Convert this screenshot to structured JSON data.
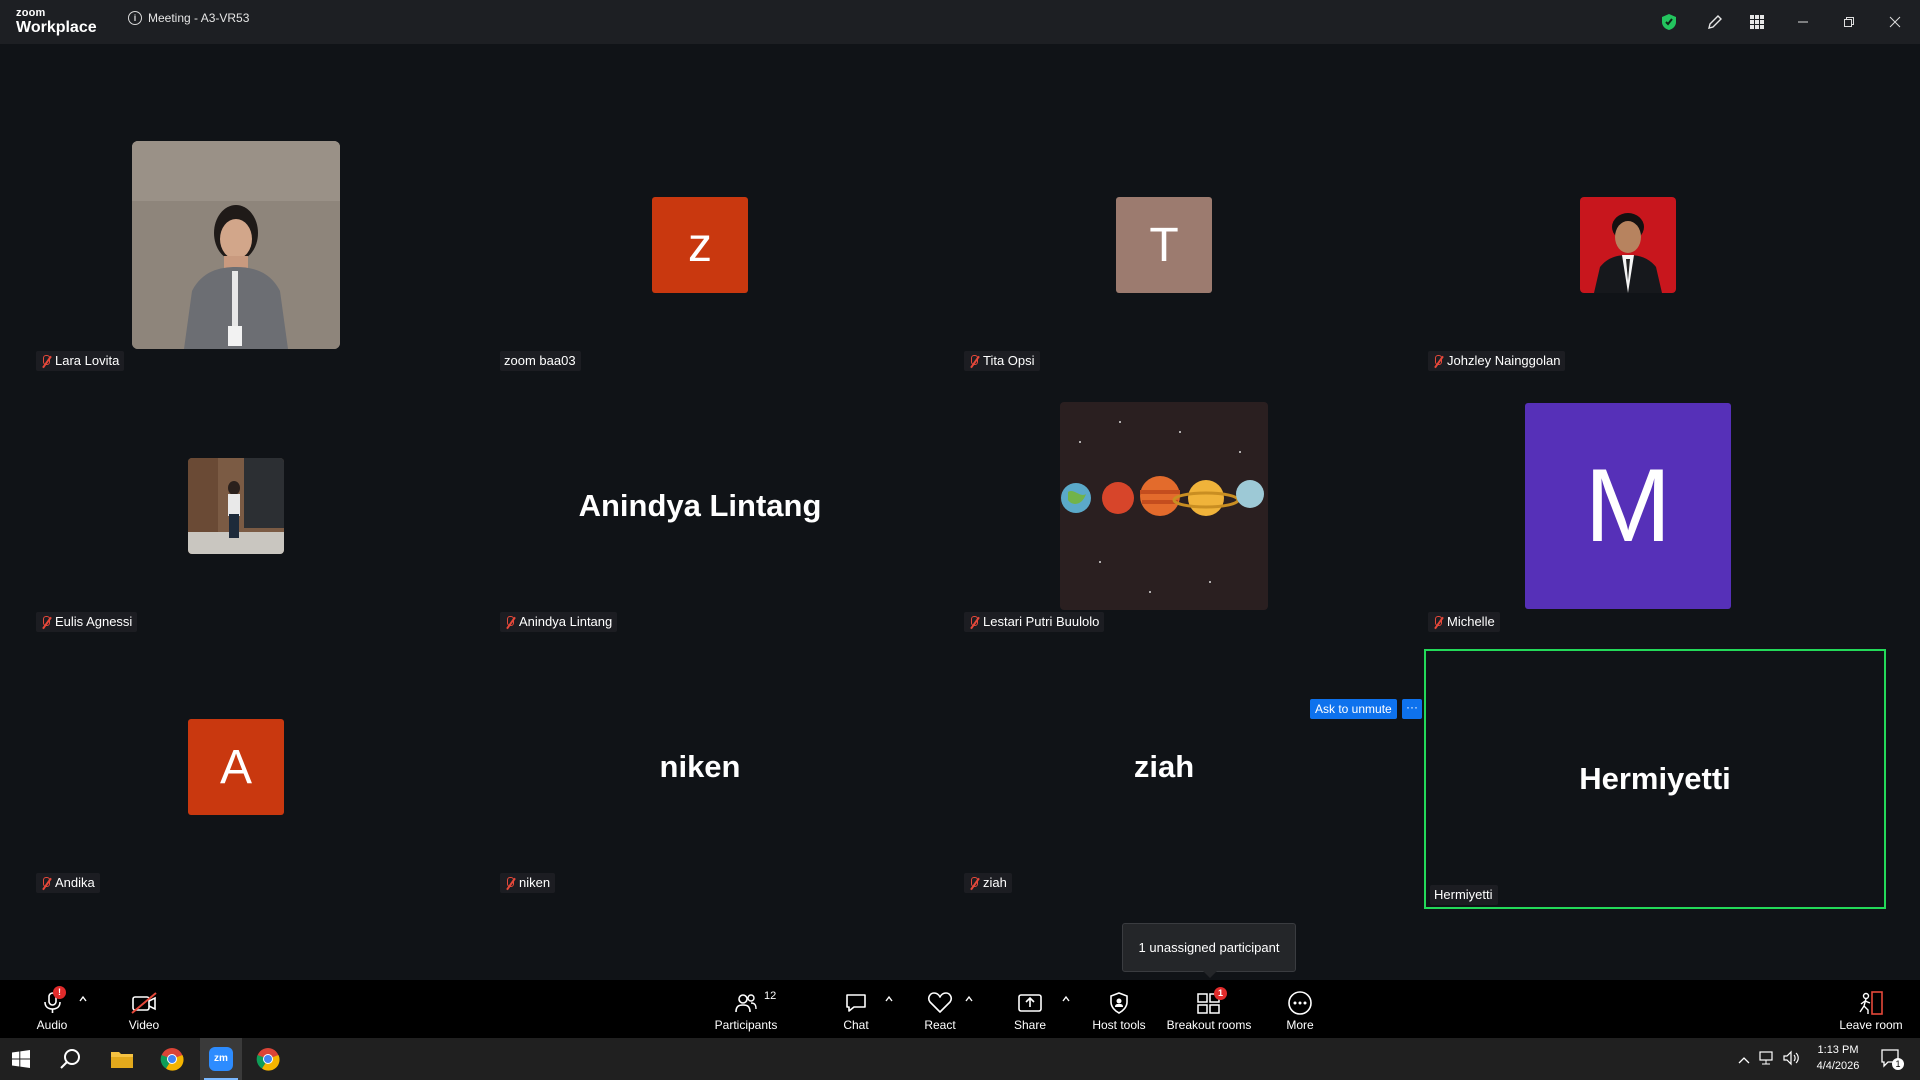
{
  "app": {
    "logo_top": "zoom",
    "logo_bottom": "Workplace",
    "meeting_title": "Meeting - A3-VR53"
  },
  "participants": [
    {
      "name": "Lara Lovita",
      "muted": true,
      "type": "photo"
    },
    {
      "name": "zoom baa03",
      "muted": false,
      "type": "initial",
      "initial": "z",
      "color": "#c9380f"
    },
    {
      "name": "Tita Opsi",
      "muted": true,
      "type": "initial",
      "initial": "T",
      "color": "#9c7b6f"
    },
    {
      "name": "Johzley Nainggolan",
      "muted": true,
      "type": "photo"
    },
    {
      "name": "Eulis Agnessi",
      "muted": true,
      "type": "photo"
    },
    {
      "name": "Anindya Lintang",
      "muted": true,
      "type": "name",
      "display": "Anindya Lintang"
    },
    {
      "name": "Lestari Putri Buulolo",
      "muted": true,
      "type": "photo"
    },
    {
      "name": "Michelle",
      "muted": true,
      "type": "initial",
      "initial": "M",
      "color": "#5630b8"
    },
    {
      "name": "Andika",
      "muted": true,
      "type": "initial",
      "initial": "A",
      "color": "#c9380f"
    },
    {
      "name": "niken",
      "muted": true,
      "type": "name",
      "display": "niken"
    },
    {
      "name": "ziah",
      "muted": true,
      "type": "name",
      "display": "ziah"
    },
    {
      "name": "Hermiyetti",
      "muted": false,
      "type": "name",
      "display": "Hermiyetti",
      "active_speaker": true
    }
  ],
  "active_tile": {
    "ask_to_unmute": "Ask to unmute",
    "more": "···"
  },
  "tooltip": "1 unassigned participant",
  "toolbar": {
    "audio": "Audio",
    "audio_badge": "!",
    "video": "Video",
    "participants": "Participants",
    "participants_count": "12",
    "chat": "Chat",
    "react": "React",
    "share": "Share",
    "host_tools": "Host tools",
    "breakout_rooms": "Breakout rooms",
    "breakout_badge": "1",
    "more": "More",
    "leave_room": "Leave room"
  },
  "taskbar": {
    "time": "1:13 PM",
    "date": "4/4/2026",
    "notification_count": "1"
  },
  "colors": {
    "active_border": "#23d959",
    "accent_blue": "#0e72ed",
    "badge_red": "#e02b2b"
  }
}
